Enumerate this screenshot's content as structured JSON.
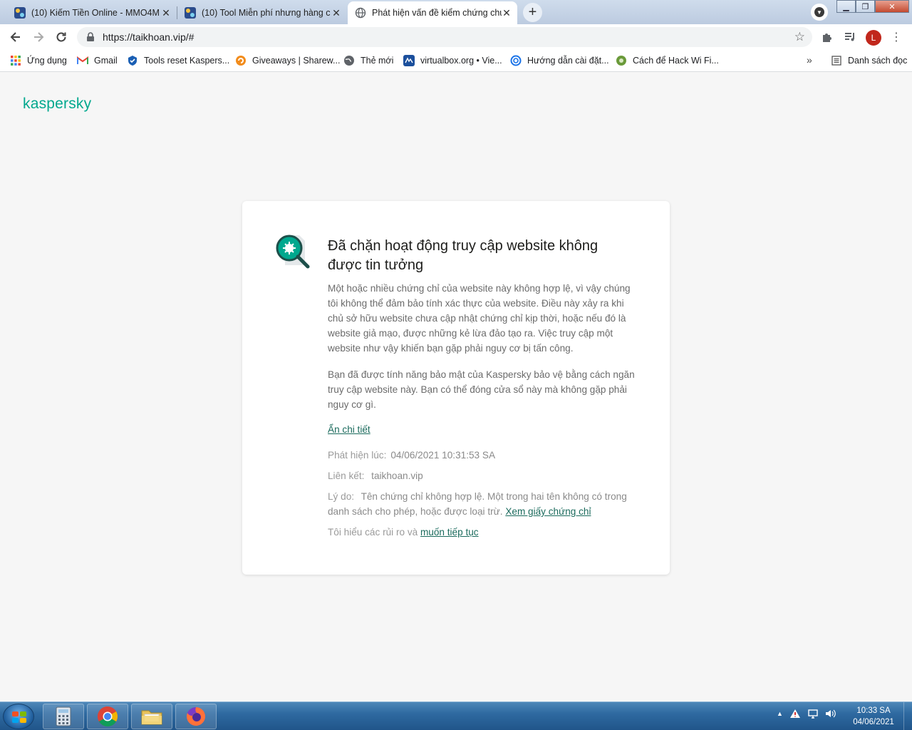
{
  "browser": {
    "tabs": [
      {
        "title": "(10) Kiếm Tiền Online - MMO4M",
        "favicon_color": "#2b4c8c"
      },
      {
        "title": "(10) Tool Miễn phí nhưng hàng c",
        "favicon_color": "#2b4c8c"
      },
      {
        "title": "Phát hiện vấn đề kiểm chứng chứ",
        "favicon": "globe-icon"
      }
    ],
    "new_tab_symbol": "+",
    "close_symbol": "✕",
    "address": "https://taikhoan.vip/#",
    "profile_initial": "L",
    "bookmarks": [
      {
        "label": "Ứng dụng",
        "icon": "apps-grid-icon"
      },
      {
        "label": "Gmail",
        "icon": "gmail-icon"
      },
      {
        "label": "Tools reset Kaspers...",
        "icon": "shield-icon"
      },
      {
        "label": "Giveaways | Sharew...",
        "icon": "giveaway-icon"
      },
      {
        "label": "Thẻ mới",
        "icon": "globe-icon"
      },
      {
        "label": "virtualbox.org • Vie...",
        "icon": "virtualbox-icon"
      },
      {
        "label": "Hướng dẫn cài đặt...",
        "icon": "swirl-icon"
      },
      {
        "label": "Cách để Hack Wi Fi...",
        "icon": "wifi-icon"
      }
    ],
    "bookmarks_more": "»",
    "reading_list": "Danh sách đọc"
  },
  "page": {
    "logo": "kaspersky",
    "title": "Đã chặn hoạt động truy cập website không được tin tưởng",
    "paragraph1": "Một hoặc nhiều chứng chỉ của website này không hợp lệ, vì vậy chúng tôi không thể đảm bảo tính xác thực của website. Điều này xảy ra khi chủ sở hữu website chưa cập nhật chứng chỉ kịp thời, hoặc nếu đó là website giả mạo, được những kẻ lừa đảo tạo ra. Việc truy cập một website như vậy khiến bạn gặp phải nguy cơ bị tấn công.",
    "paragraph2": "Bạn đã được tính năng bảo mật của Kaspersky bảo vệ bằng cách ngăn truy cập website này. Bạn có thể đóng cửa sổ này mà không gặp phải nguy cơ gì.",
    "hide_details": "Ẩn chi tiết",
    "detected_label": "Phát hiện lúc:",
    "detected_value": "04/06/2021 10:31:53 SA",
    "link_label": "Liên kết:",
    "link_value": "taikhoan.vip",
    "reason_label": "Lý do:",
    "reason_value": "Tên chứng chỉ không hợp lệ. Một trong hai tên không có trong danh sách cho phép, hoặc được loại trừ.",
    "view_cert": "Xem giấy chứng chỉ",
    "risk_text": "Tôi hiểu các rủi ro và",
    "continue_link": "muốn tiếp tục",
    "accent_color": "#00a88e"
  },
  "taskbar": {
    "apps": [
      "calculator-icon",
      "chrome-icon",
      "file-explorer-icon",
      "firefox-icon"
    ],
    "tray_arrow": "▲",
    "time": "10:33 SA",
    "date": "04/06/2021"
  }
}
